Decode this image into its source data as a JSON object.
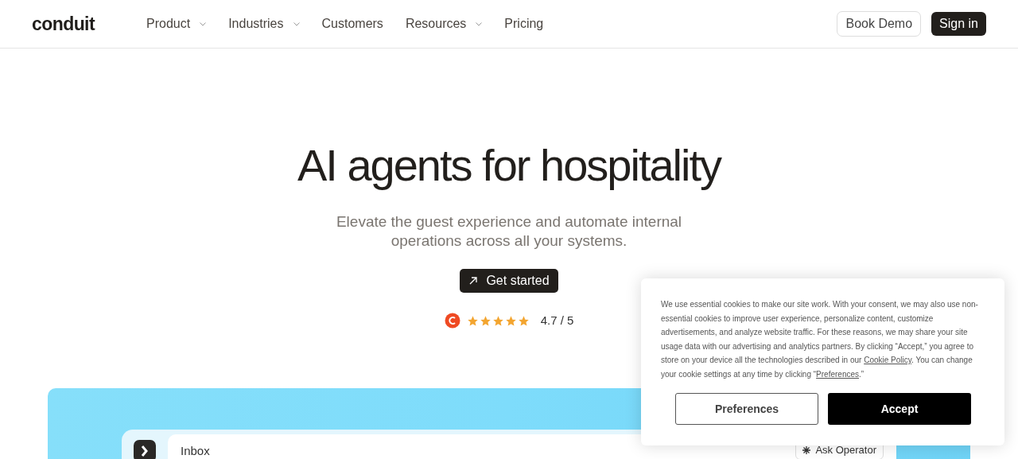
{
  "logo": "conduit",
  "nav": [
    {
      "label": "Product",
      "has_dropdown": true
    },
    {
      "label": "Industries",
      "has_dropdown": true
    },
    {
      "label": "Customers",
      "has_dropdown": false
    },
    {
      "label": "Resources",
      "has_dropdown": true
    },
    {
      "label": "Pricing",
      "has_dropdown": false
    }
  ],
  "header_buttons": {
    "book_demo": "Book Demo",
    "sign_in": "Sign in"
  },
  "hero": {
    "title": "AI agents for hospitality",
    "subtitle": "Elevate the guest experience and automate internal operations across all your systems.",
    "cta": "Get started",
    "rating": {
      "stars": 5,
      "score": "4.7 / 5"
    }
  },
  "app_preview": {
    "inbox_title": "Inbox",
    "ask_operator": "Ask Operator"
  },
  "cookie_banner": {
    "text_parts": [
      {
        "kind": "text",
        "text": "We use essential cookies to make our site work. With your consent, we may also use non-essential cookies to improve user experience, personalize content, customize advertisements, and analyze website traffic. For these reasons, we may share your site usage data with our advertising and analytics partners. By clicking “Accept,” you agree to store on your device all the technologies described in our "
      },
      {
        "kind": "link",
        "text": "Cookie Policy"
      },
      {
        "kind": "text",
        "text": ". You can change your cookie settings at any time by clicking “"
      },
      {
        "kind": "link",
        "text": "Preferences"
      },
      {
        "kind": "text",
        "text": ".”"
      }
    ],
    "buttons": [
      "Preferences",
      "Accept"
    ]
  }
}
